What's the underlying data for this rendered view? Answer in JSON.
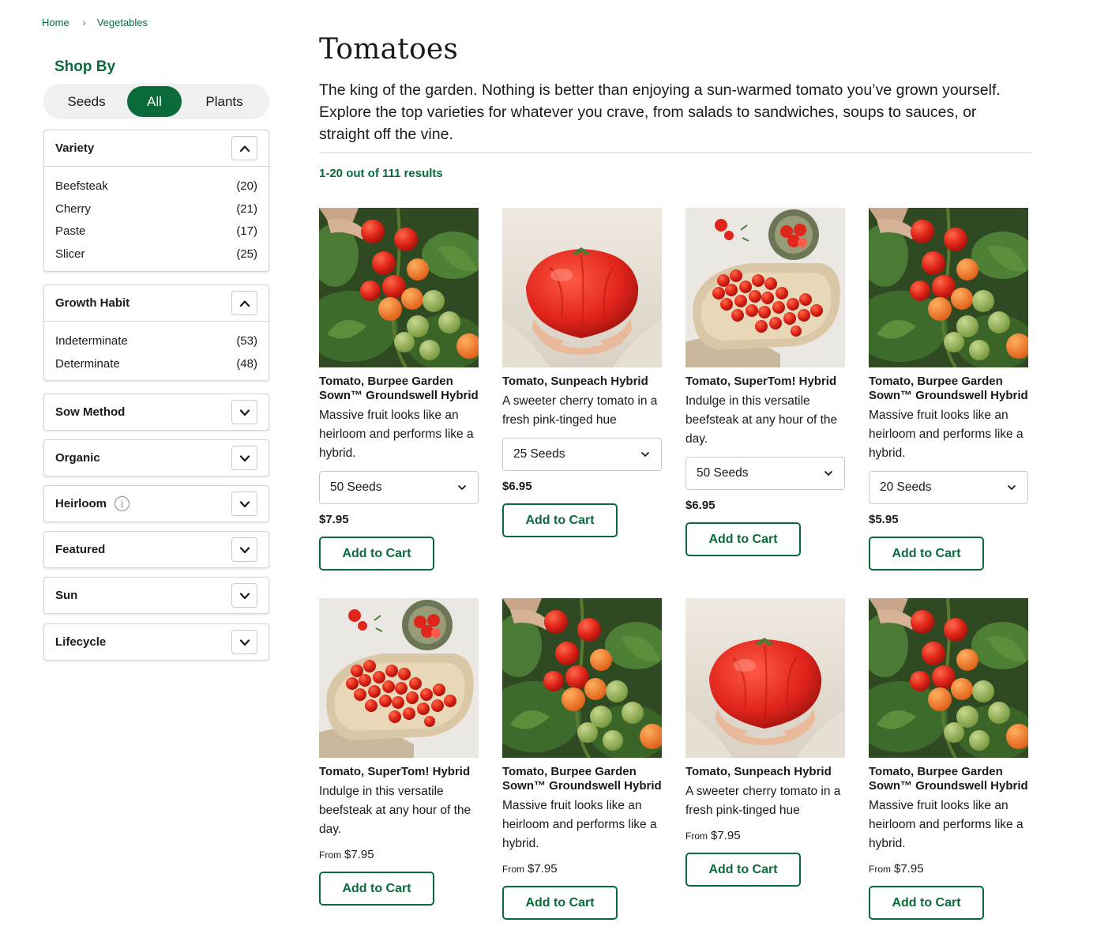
{
  "breadcrumb": {
    "home": "Home",
    "current": "Vegetables"
  },
  "shop_by": {
    "title": "Shop By",
    "options": {
      "seeds": "Seeds",
      "all": "All",
      "plants": "Plants"
    },
    "selected": "All"
  },
  "facets": {
    "variety": {
      "label": "Variety",
      "expanded": true,
      "rows": [
        {
          "label": "Beefsteak",
          "count": "(20)"
        },
        {
          "label": "Cherry",
          "count": "(21)"
        },
        {
          "label": "Paste",
          "count": "(17)"
        },
        {
          "label": "Slicer",
          "count": "(25)"
        }
      ]
    },
    "growth_habit": {
      "label": "Growth Habit",
      "expanded": true,
      "rows": [
        {
          "label": "Indeterminate",
          "count": "(53)"
        },
        {
          "label": "Determinate",
          "count": "(48)"
        }
      ]
    },
    "sow_method": {
      "label": "Sow Method"
    },
    "organic": {
      "label": "Organic"
    },
    "heirloom": {
      "label": "Heirloom",
      "info": "i"
    },
    "featured": {
      "label": "Featured"
    },
    "sun": {
      "label": "Sun"
    },
    "lifecycle": {
      "label": "Lifecycle"
    }
  },
  "main": {
    "title": "Tomatoes",
    "description": "The king of the garden. Nothing is better than enjoying a sun-warmed tomato you’ve grown yourself. Explore the top varieties for whatever you crave, from salads to sandwiches, soups to sauces, or straight off the vine.",
    "results": "1-20 out of 111 results"
  },
  "products": [
    {
      "name": "Tomato, Burpee Garden Sown™ Groundswell Hybrid",
      "desc": "Massive fruit looks like an heirloom and performs like a hybrid.",
      "select": "50 Seeds",
      "price": "$7.95",
      "cta": "Add to Cart",
      "image": "vine-cluster"
    },
    {
      "name": "Tomato, Sunpeach Hybrid",
      "desc": "A sweeter cherry tomato in a fresh pink-tinged hue",
      "select": "25 Seeds",
      "price": "$6.95",
      "cta": "Add to Cart",
      "image": "held-beefsteak"
    },
    {
      "name": "Tomato, SuperTom! Hybrid",
      "desc": "Indulge in this versatile beefsteak at any hour of the day.",
      "select": "50 Seeds",
      "price": "$6.95",
      "cta": "Add to Cart",
      "image": "cherry-board"
    },
    {
      "name": "Tomato, Burpee Garden Sown™ Groundswell Hybrid",
      "desc": "Massive fruit looks like an heirloom and performs like a hybrid.",
      "select": "20 Seeds",
      "price": "$5.95",
      "cta": "Add to Cart",
      "image": "vine-cluster"
    },
    {
      "name": "Tomato, SuperTom! Hybrid",
      "desc": "Indulge in this versatile beefsteak at any hour of the day.",
      "from": "From",
      "price": "$7.95",
      "cta": "Add to Cart",
      "image": "cherry-board"
    },
    {
      "name": "Tomato, Burpee Garden Sown™ Groundswell Hybrid",
      "desc": "Massive fruit looks like an heirloom and performs like a hybrid.",
      "from": "From",
      "price": "$7.95",
      "cta": "Add to Cart",
      "image": "vine-cluster"
    },
    {
      "name": "Tomato, Sunpeach Hybrid",
      "desc": "A sweeter cherry tomato in a fresh pink-tinged hue",
      "from": "From",
      "price": "$7.95",
      "cta": "Add to Cart",
      "image": "held-beefsteak"
    },
    {
      "name": "Tomato, Burpee Garden Sown™ Groundswell Hybrid",
      "desc": "Massive fruit looks like an heirloom and performs like a hybrid.",
      "from": "From",
      "price": "$7.95",
      "cta": "Add to Cart",
      "image": "vine-cluster"
    }
  ],
  "colors": {
    "brand_green": "#0b6a3a",
    "border": "#d5d5d5",
    "toggle_bg": "#f0f0f0"
  }
}
